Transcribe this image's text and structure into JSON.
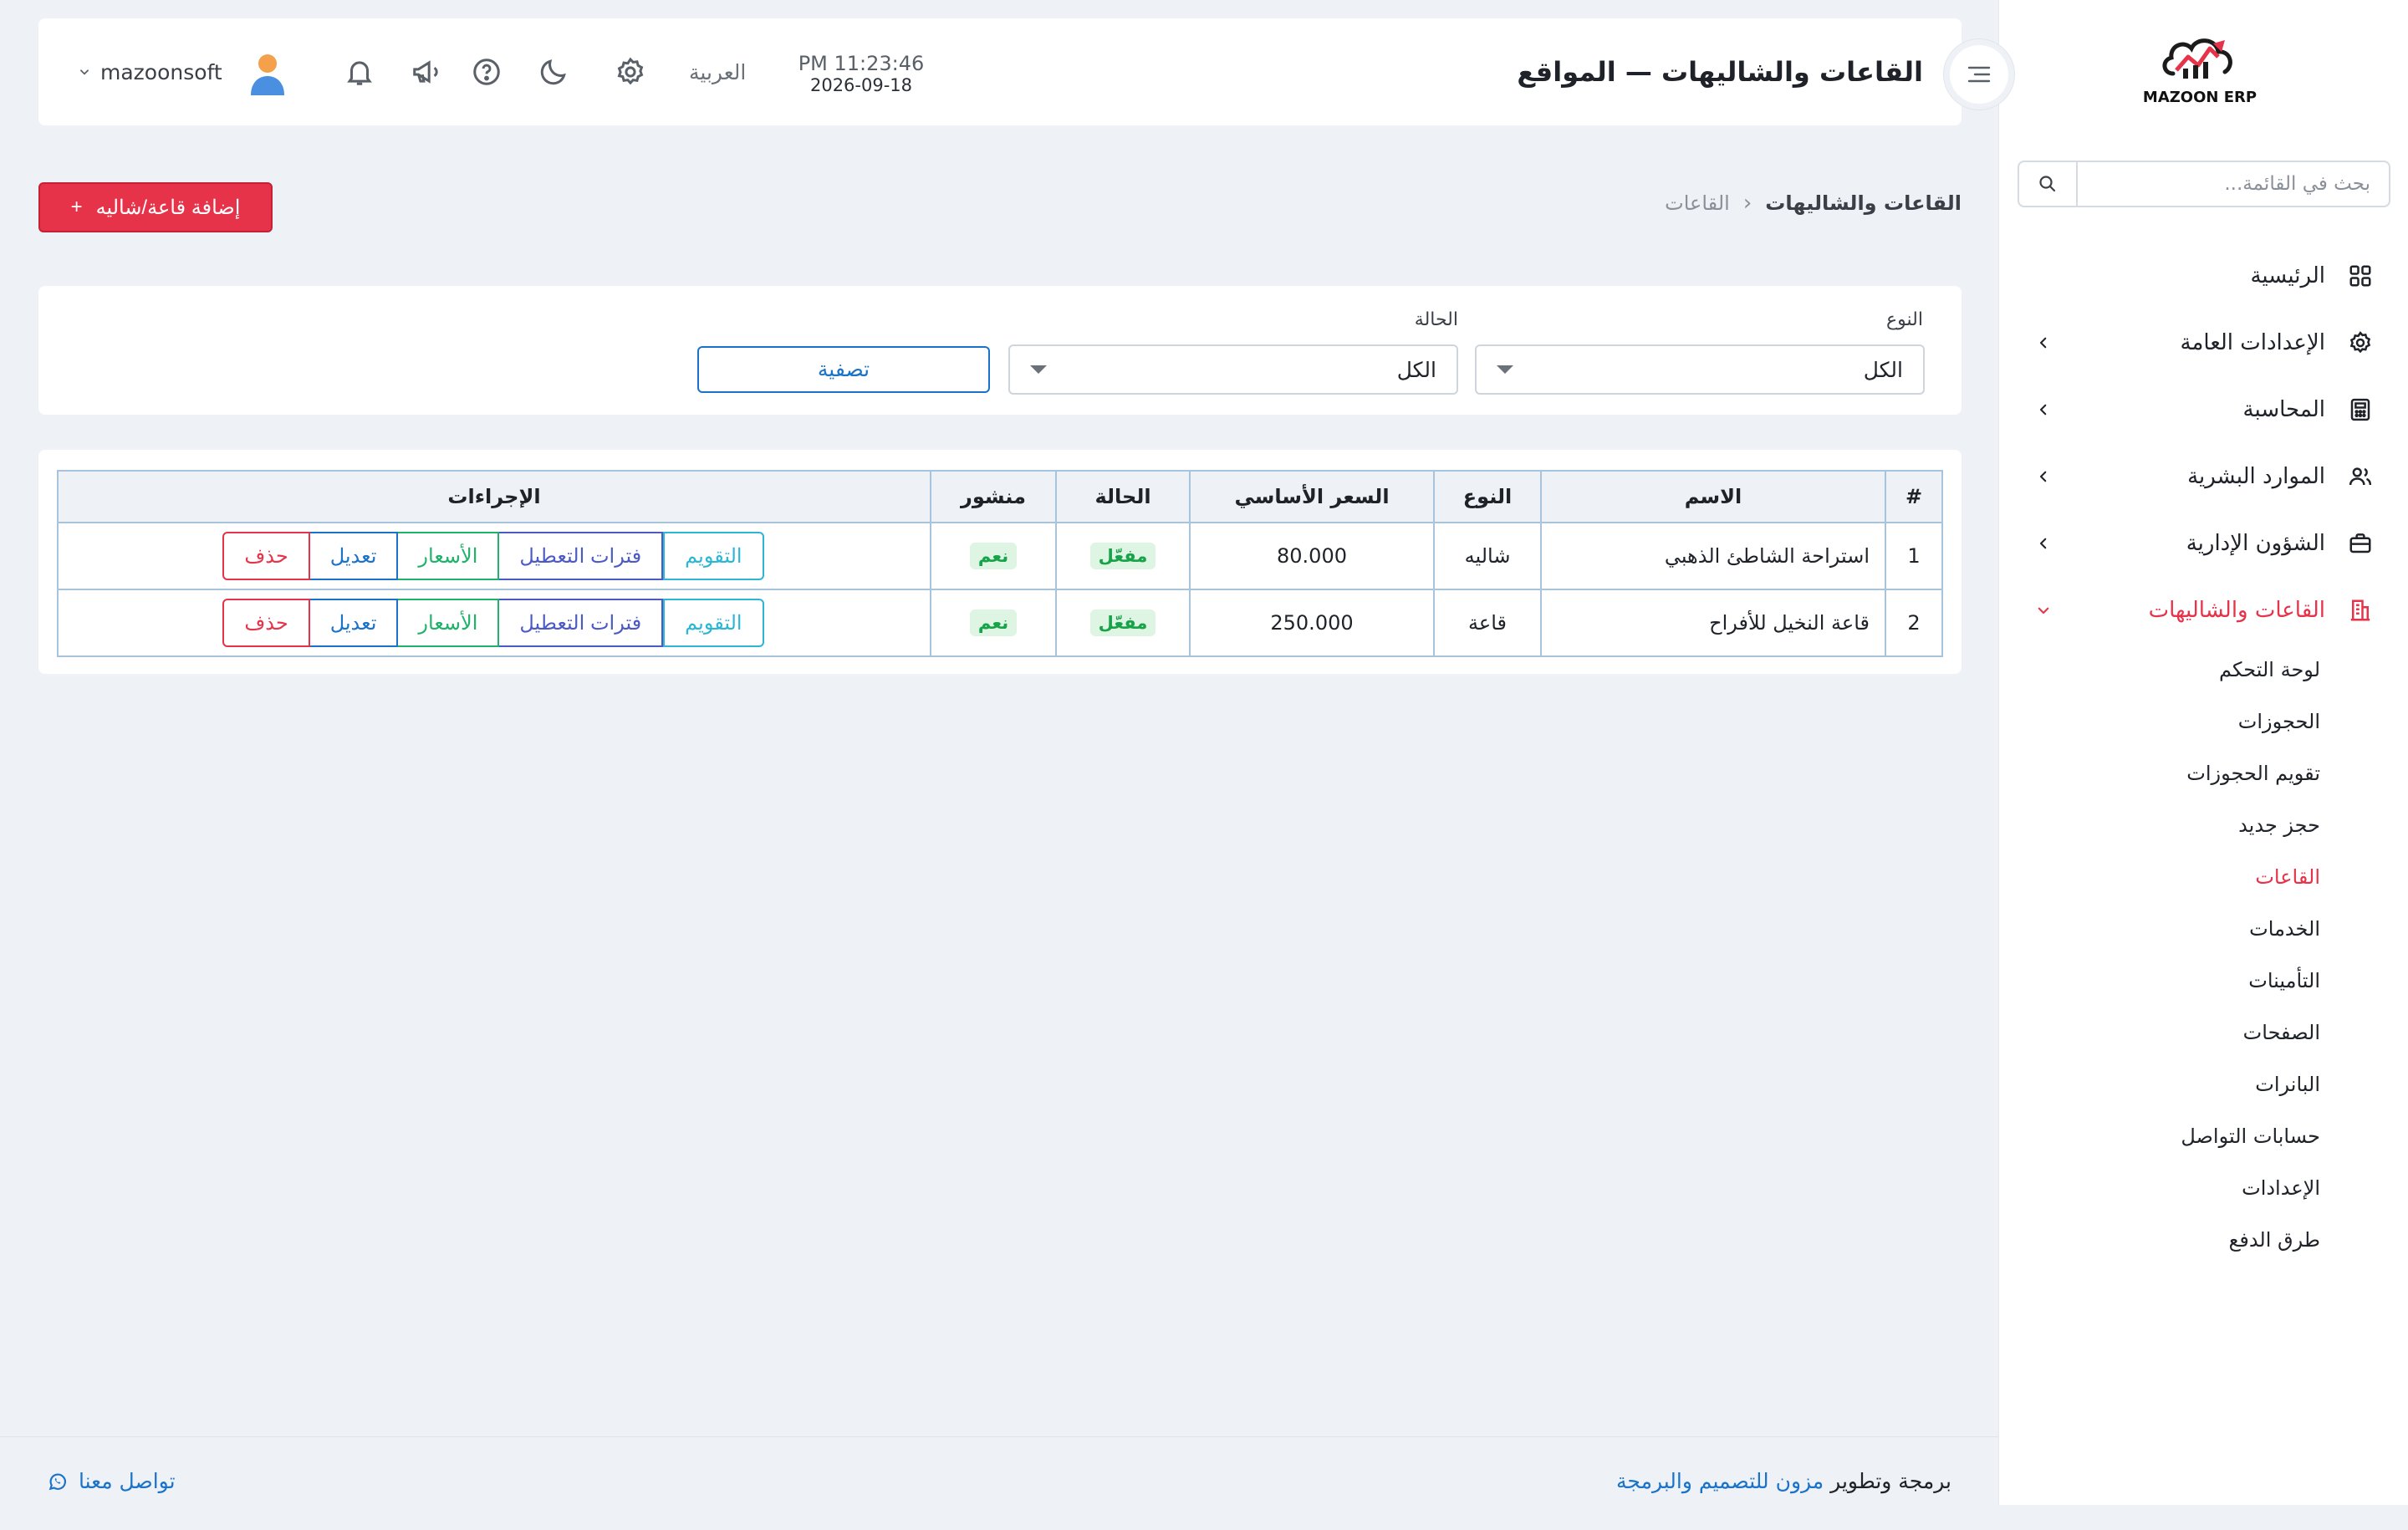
{
  "app": {
    "logo_text": "MAZOON ERP"
  },
  "sidebar": {
    "search_placeholder": "بحث في القائمة...",
    "items": [
      {
        "label": "الرئيسية",
        "icon": "grid-icon",
        "expandable": false
      },
      {
        "label": "الإعدادات العامة",
        "icon": "gear-icon",
        "expandable": true
      },
      {
        "label": "المحاسبة",
        "icon": "calculator-icon",
        "expandable": true
      },
      {
        "label": "الموارد البشرية",
        "icon": "users-icon",
        "expandable": true
      },
      {
        "label": "الشؤون الإدارية",
        "icon": "briefcase-icon",
        "expandable": true
      },
      {
        "label": "القاعات والشاليهات",
        "icon": "building-icon",
        "expandable": true,
        "active": true
      }
    ],
    "submenu": [
      {
        "label": "لوحة التحكم"
      },
      {
        "label": "الحجوزات"
      },
      {
        "label": "تقويم الحجوزات"
      },
      {
        "label": "حجز جديد"
      },
      {
        "label": "القاعات",
        "active": true
      },
      {
        "label": "الخدمات"
      },
      {
        "label": "التأمينات"
      },
      {
        "label": "الصفحات"
      },
      {
        "label": "البانرات"
      },
      {
        "label": "حسابات التواصل"
      },
      {
        "label": "الإعدادات"
      },
      {
        "label": "طرق الدفع"
      }
    ]
  },
  "header": {
    "title": "القاعات والشاليهات — المواقع",
    "time": "PM 11:23:46",
    "date": "2026-09-18",
    "language": "العربية",
    "username": "mazoonsoft"
  },
  "breadcrumb": {
    "root": "القاعات والشاليهات",
    "separator": "‹",
    "current": "القاعات"
  },
  "add_button": {
    "label": "إضافة قاعة/شاليه",
    "plus": "+"
  },
  "filters": {
    "type_label": "النوع",
    "type_value": "الكل",
    "status_label": "الحالة",
    "status_value": "الكل",
    "filter_button": "تصفية"
  },
  "table": {
    "headers": {
      "num": "#",
      "name": "الاسم",
      "type": "النوع",
      "price": "السعر الأساسي",
      "status": "الحالة",
      "published": "منشور",
      "actions": "الإجراءات"
    },
    "rows": [
      {
        "num": "1",
        "name": "استراحة الشاطئ الذهبي",
        "type": "شاليه",
        "price": "80.000",
        "status": "مفعّل",
        "published": "نعم"
      },
      {
        "num": "2",
        "name": "قاعة النخيل للأفراح",
        "type": "قاعة",
        "price": "250.000",
        "status": "مفعّل",
        "published": "نعم"
      }
    ],
    "action_labels": {
      "calendar": "التقويم",
      "off_periods": "فترات التعطيل",
      "prices": "الأسعار",
      "edit": "تعديل",
      "delete": "حذف"
    }
  },
  "footer": {
    "credit_prefix": "برمجة وتطوير",
    "credit_link": "مزون للتصميم والبرمجة",
    "contact": "تواصل معنا"
  },
  "colors": {
    "accent": "#e6334a",
    "link": "#1a73c9",
    "success": "#17a34a",
    "background": "#eef2f6"
  }
}
